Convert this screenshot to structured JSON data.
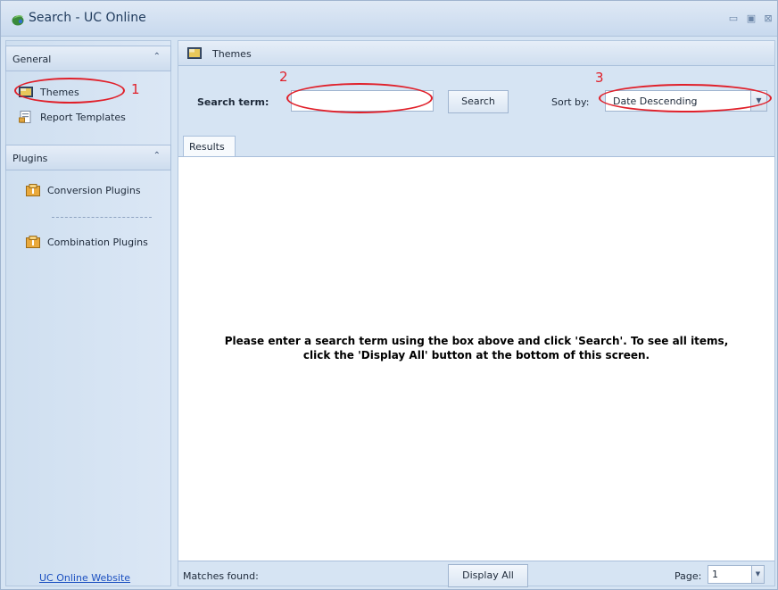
{
  "window": {
    "title": "Search - UC Online",
    "controls": {
      "minimize": "▭",
      "maximize": "▣",
      "close": "⊠"
    }
  },
  "sidebar": {
    "groups": [
      {
        "label": "General",
        "items": [
          {
            "label": "Themes",
            "icon": "theme-icon"
          },
          {
            "label": "Report Templates",
            "icon": "report-template-icon"
          }
        ]
      },
      {
        "label": "Plugins",
        "items": [
          {
            "label": "Conversion Plugins",
            "icon": "plugin-icon"
          },
          {
            "label": "Combination Plugins",
            "icon": "plugin-icon"
          }
        ]
      }
    ],
    "collapse_glyph": "⌃",
    "website_link": "UC Online Website"
  },
  "main": {
    "header_title": "Themes",
    "search_label": "Search term:",
    "search_value": "",
    "search_button": "Search",
    "sort_label": "Sort by:",
    "sort_value": "Date Descending",
    "dropdown_arrow": "▼",
    "tabs": [
      {
        "label": "Results",
        "active": true
      }
    ],
    "results_message_line1": "Please enter a search term using the box above and click 'Search'. To see all items,",
    "results_message_line2": "click the 'Display All' button at the bottom of this screen."
  },
  "footer": {
    "matches_label": "Matches found:",
    "display_all_button": "Display All",
    "page_label": "Page:",
    "page_value": "1"
  },
  "annotations": {
    "n1": "1",
    "n2": "2",
    "n3": "3",
    "color": "#e0202a"
  }
}
